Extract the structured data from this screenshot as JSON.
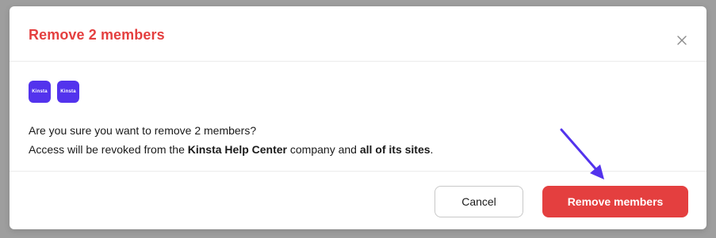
{
  "modal": {
    "title": "Remove 2 members",
    "close_symbol": "×",
    "close_icon": "close-icon"
  },
  "avatars": [
    {
      "label": "Kinsta"
    },
    {
      "label": "Kinsta"
    }
  ],
  "message": {
    "line1": "Are you sure you want to remove 2 members?",
    "line2_prefix": "Access will be revoked from the ",
    "company": "Kinsta Help Center",
    "line2_middle": " company and ",
    "emphasis": "all of its sites",
    "line2_suffix": "."
  },
  "footer": {
    "cancel_label": "Cancel",
    "remove_label": "Remove members"
  },
  "colors": {
    "title": "#e43f3f",
    "danger_button": "#e43f3f",
    "avatar_bg": "#5333ed",
    "annotation_arrow": "#5333ed"
  }
}
